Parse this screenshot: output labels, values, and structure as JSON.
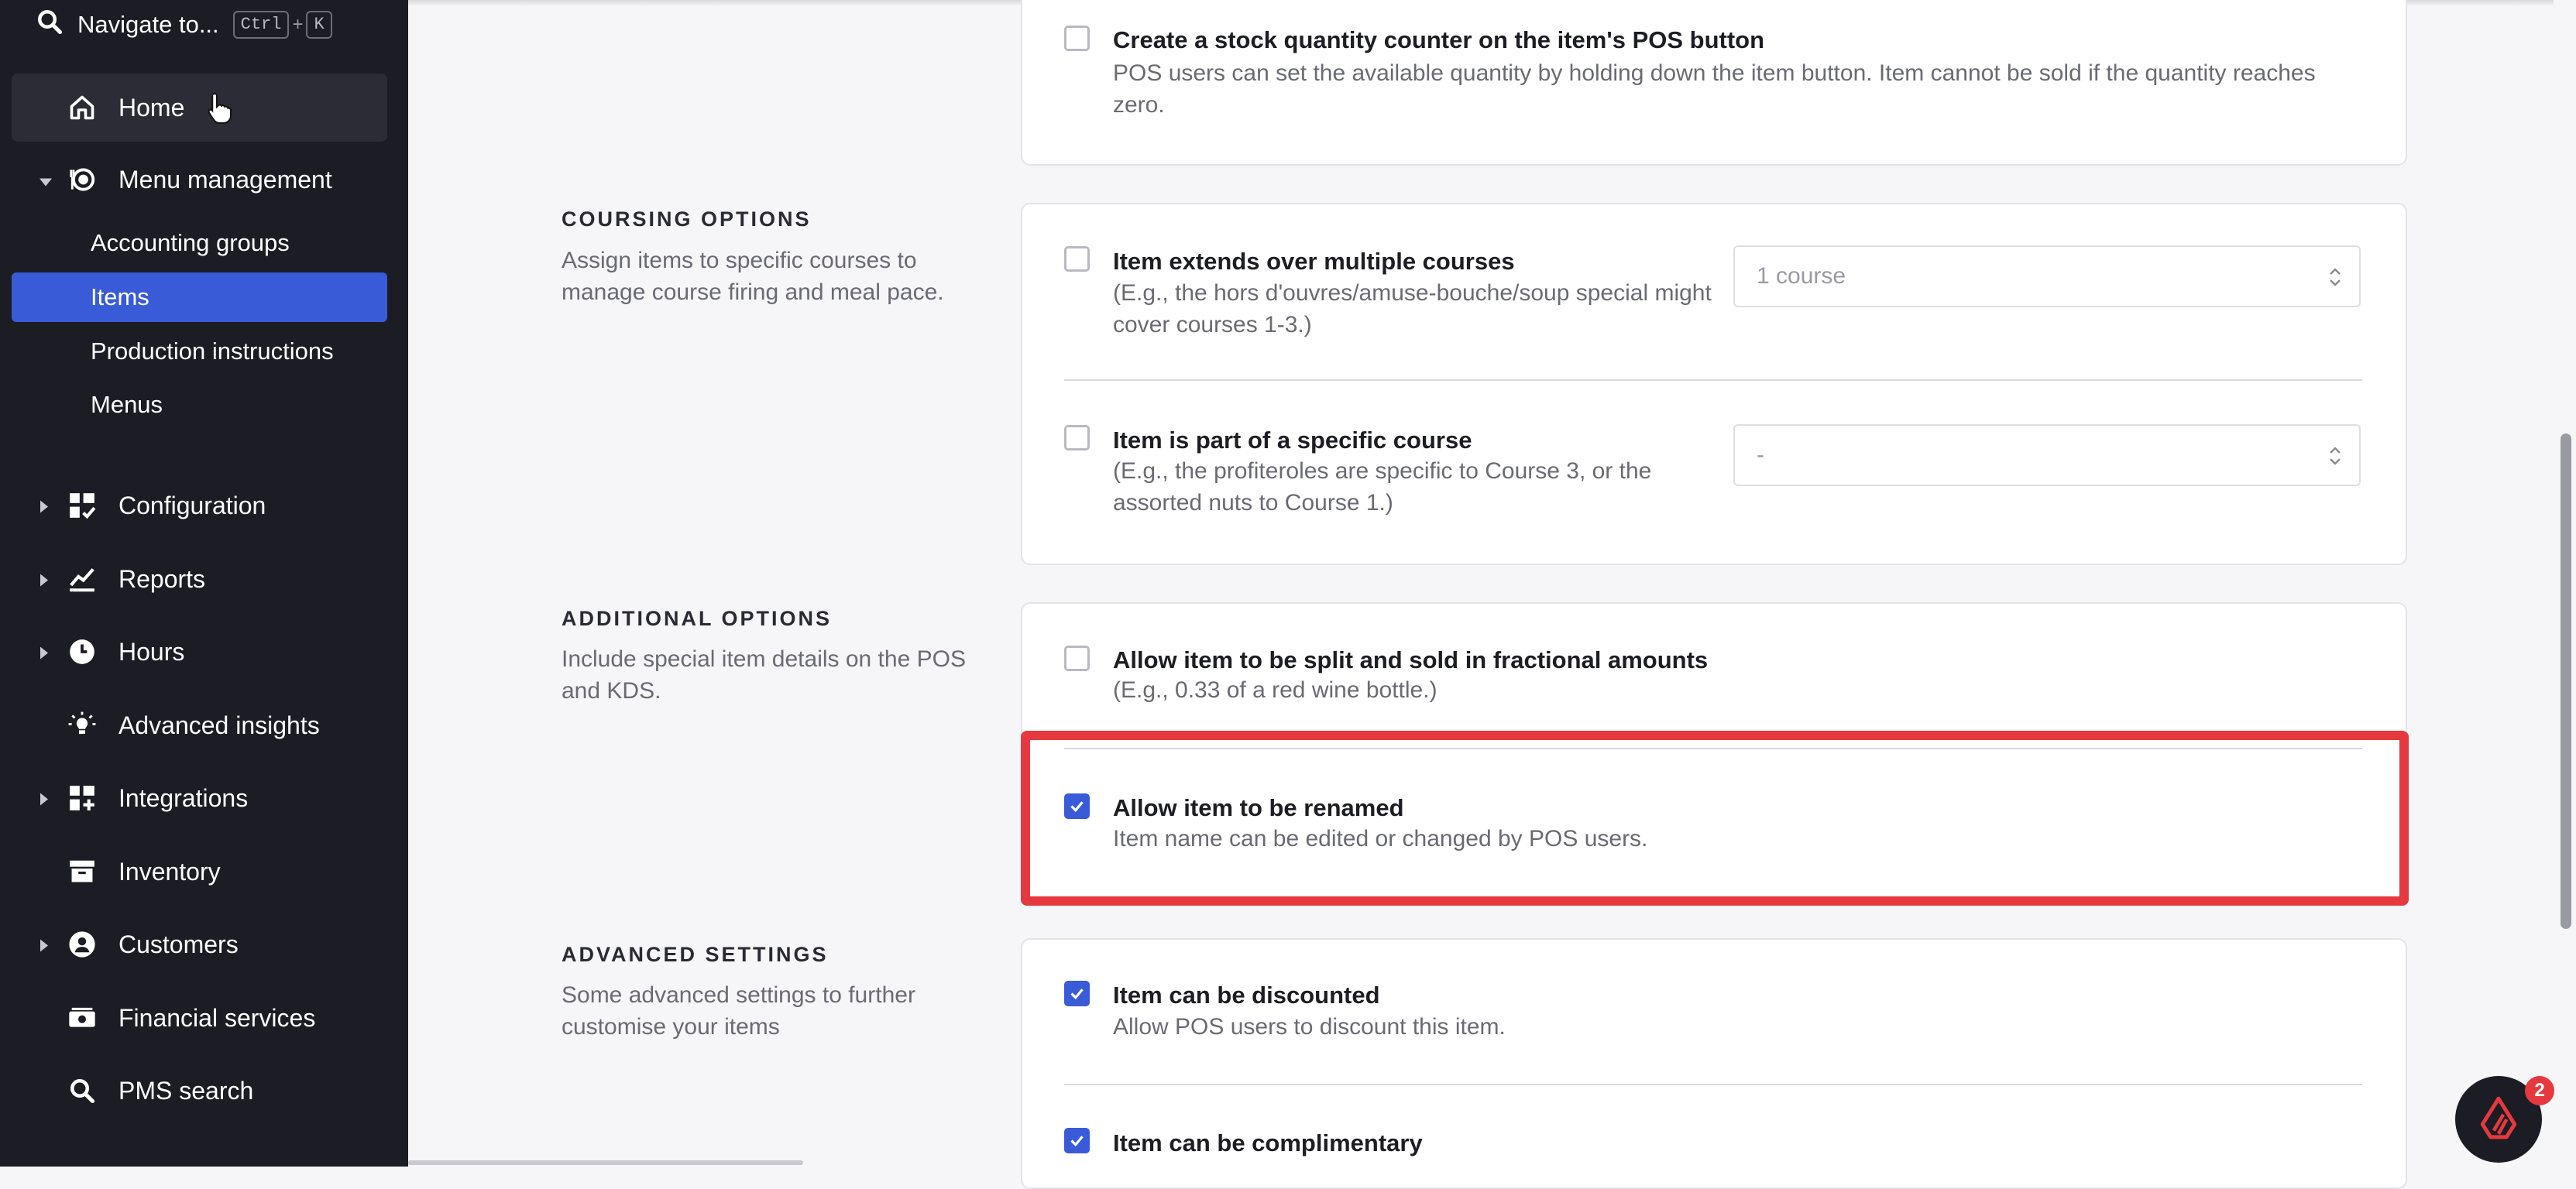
{
  "sidebar": {
    "search_label": "Navigate to...",
    "shortcut_ctrl": "Ctrl",
    "shortcut_plus": "+",
    "shortcut_key": "K",
    "home": "Home",
    "menu_management": "Menu management",
    "sub_items": {
      "accounting_groups": "Accounting groups",
      "items": "Items",
      "production_instructions": "Production instructions",
      "menus": "Menus"
    },
    "configuration": "Configuration",
    "reports": "Reports",
    "hours": "Hours",
    "advanced_insights": "Advanced insights",
    "integrations": "Integrations",
    "inventory": "Inventory",
    "customers": "Customers",
    "financial_services": "Financial services",
    "pms_search": "PMS search"
  },
  "stock_counter": {
    "title": "Create a stock quantity counter on the item's POS button",
    "desc_line1": "POS users can set the available quantity by holding down the item button. Item cannot be sold if the quantity reaches",
    "desc_line2": "zero.",
    "checked": false
  },
  "coursing": {
    "heading": "COURSING OPTIONS",
    "desc": "Assign items to specific courses to manage course firing and meal pace.",
    "multiple": {
      "title": "Item extends over multiple courses",
      "desc": "(E.g., the hors d'ouvres/amuse-bouche/soup special might cover courses 1-3.)",
      "select_value": "1 course",
      "checked": false
    },
    "specific": {
      "title": "Item is part of a specific course",
      "desc": "(E.g., the profiteroles are specific to Course 3, or the assorted nuts to Course 1.)",
      "select_value": "-",
      "checked": false
    }
  },
  "additional": {
    "heading": "ADDITIONAL OPTIONS",
    "desc": "Include special item details on the POS and KDS.",
    "fractional": {
      "title": "Allow item to be split and sold in fractional amounts",
      "desc": "(E.g., 0.33 of a red wine bottle.)",
      "checked": false
    },
    "renamed": {
      "title": "Allow item to be renamed",
      "desc": "Item name can be edited or changed by POS users.",
      "checked": true
    }
  },
  "advanced": {
    "heading": "ADVANCED SETTINGS",
    "desc": "Some advanced settings to further customise your items",
    "discounted": {
      "title": "Item can be discounted",
      "desc": "Allow POS users to discount this item.",
      "checked": true
    },
    "complimentary": {
      "title": "Item can be complimentary",
      "checked": true
    }
  },
  "chat": {
    "badge": "2"
  },
  "colors": {
    "accent": "#3a5bd8",
    "highlight": "#e5393f",
    "sidebar": "#1c1c24"
  }
}
